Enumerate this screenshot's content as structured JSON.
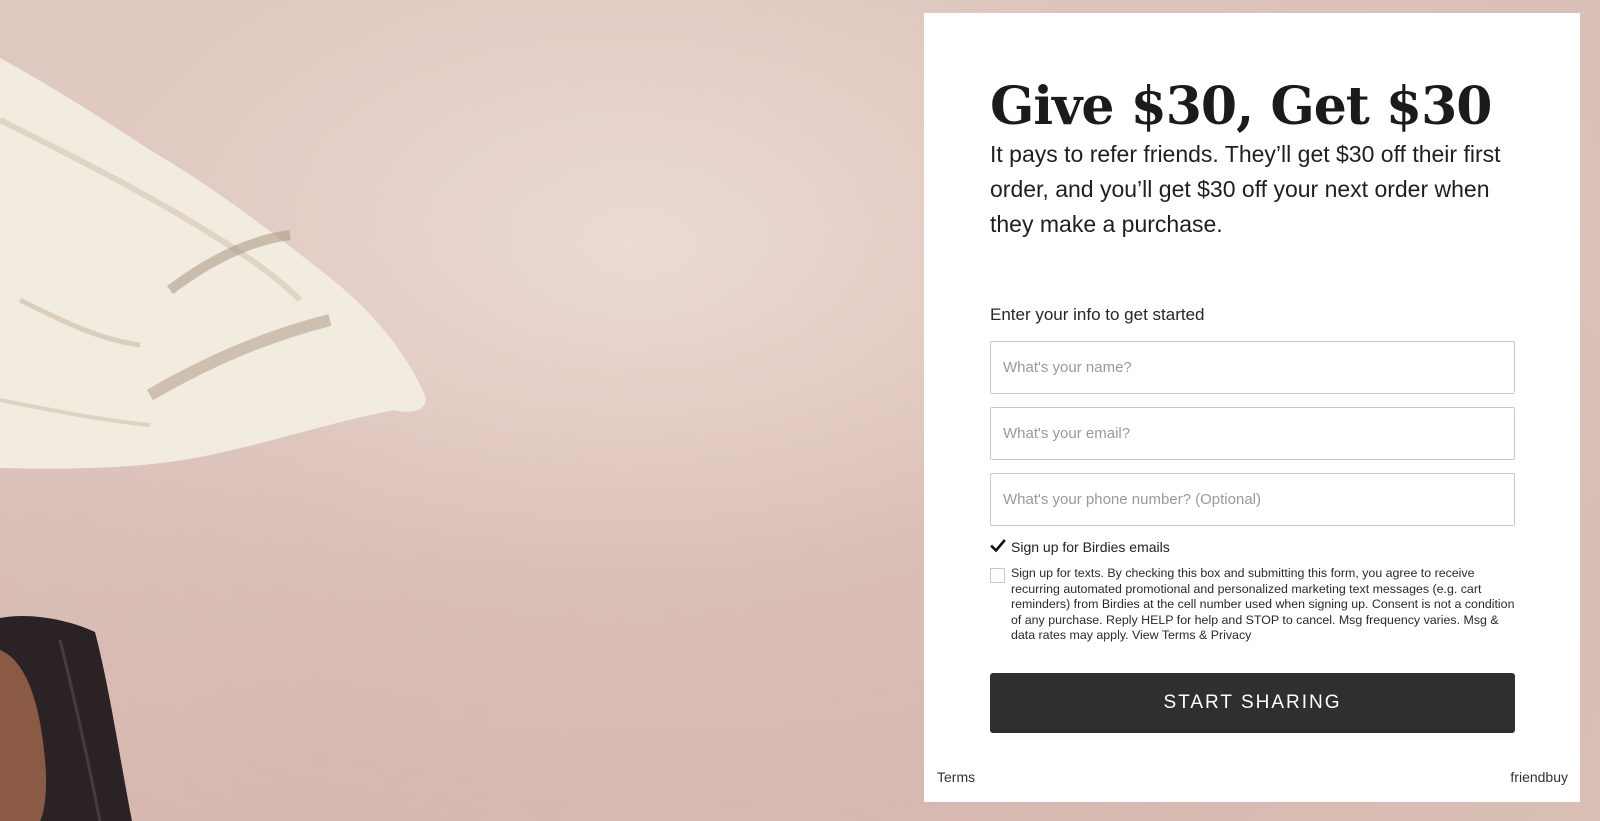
{
  "hero": {
    "title": "Give $30, Get $30",
    "subtitle": "It pays to refer friends. They’ll get $30 off their first order, and you’ll get $30 off your next order when they make a purchase."
  },
  "form": {
    "label": "Enter your info to get started",
    "name_placeholder": "What's your name?",
    "email_placeholder": "What's your email?",
    "phone_placeholder": "What's your phone number? (Optional)",
    "email_optin": {
      "label": "Sign up for Birdies emails",
      "checked": true
    },
    "sms_optin": {
      "label": "Sign up for texts. By checking this box and submitting this form, you agree to receive recurring automated promotional and personalized marketing text messages (e.g. cart reminders) from Birdies at the cell number used when signing up. Consent is not a condition of any purchase. Reply HELP for help and STOP to cancel. Msg frequency varies. Msg & data rates may apply. View Terms & Privacy",
      "checked": false
    },
    "submit_label": "START SHARING"
  },
  "footer": {
    "terms_label": "Terms",
    "brand_label": "friendbuy"
  },
  "colors": {
    "button_bg": "#2f2f2f",
    "card_bg": "#ffffff",
    "background": "#dcc2ba"
  }
}
